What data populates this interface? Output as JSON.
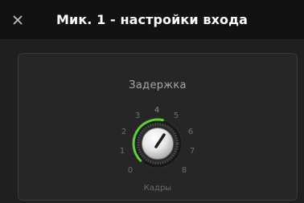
{
  "window": {
    "title": "Мик. 1 - настройки входа",
    "close_icon": "close-icon"
  },
  "delay": {
    "label": "Задержка",
    "unit_label": "Кадры",
    "value": 4,
    "min": 0,
    "max": 8,
    "scale": [
      "0",
      "1",
      "2",
      "3",
      "4",
      "5",
      "6",
      "7",
      "8"
    ]
  },
  "colors": {
    "accent": "#5dd12e",
    "background": "#1f1f1f",
    "panel": "#262626",
    "title_bar": "#121212"
  }
}
